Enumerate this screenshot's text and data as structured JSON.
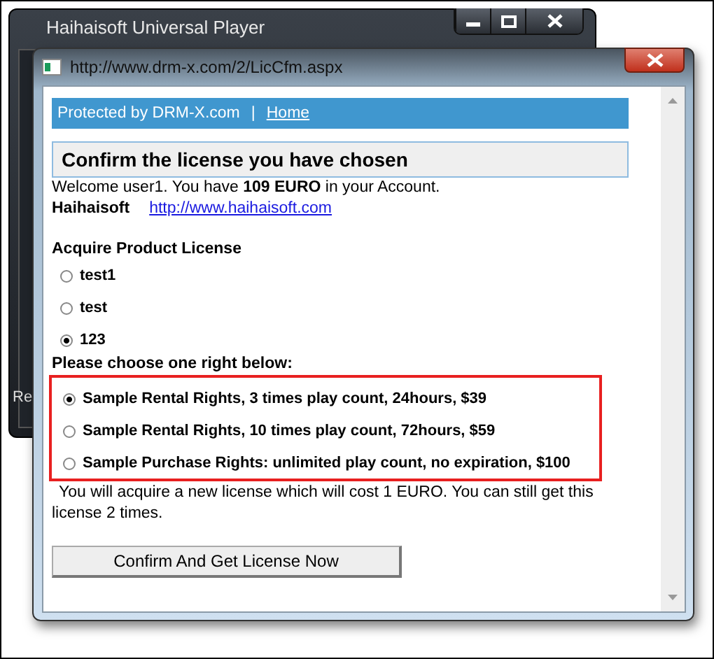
{
  "background_window": {
    "title": "Haihaisoft Universal Player",
    "partial_label": "Re"
  },
  "dialog": {
    "title": "http://www.drm-x.com/2/LicCfm.aspx"
  },
  "header_bar": {
    "text": "Protected by DRM-X.com",
    "separator": "|",
    "link": "Home"
  },
  "heading": "Confirm the license you have chosen",
  "welcome": "Welcome user1. You have **109 EURO** in your Account.",
  "publisher": {
    "name": "Haihaisoft",
    "link": "http://www.haihaisoft.com"
  },
  "product_section": {
    "title": "Acquire Product License",
    "options": [
      {
        "label": "test1",
        "selected": false
      },
      {
        "label": "test",
        "selected": false
      },
      {
        "label": "123",
        "selected": true
      }
    ]
  },
  "rights_section": {
    "title": "Please choose one right below:",
    "options": [
      {
        "label": "Sample Rental Rights, 3 times play count, 24hours, $39",
        "selected": true
      },
      {
        "label": "Sample Rental Rights, 10 times play count, 72hours, $59",
        "selected": false
      },
      {
        "label": "Sample Purchase Rights: unlimited play count, no expiration, $100",
        "selected": false
      }
    ]
  },
  "notice": "You will acquire a new license which will cost 1 EURO. You can still get this license 2 times.",
  "confirm_button": "Confirm And Get License Now"
}
